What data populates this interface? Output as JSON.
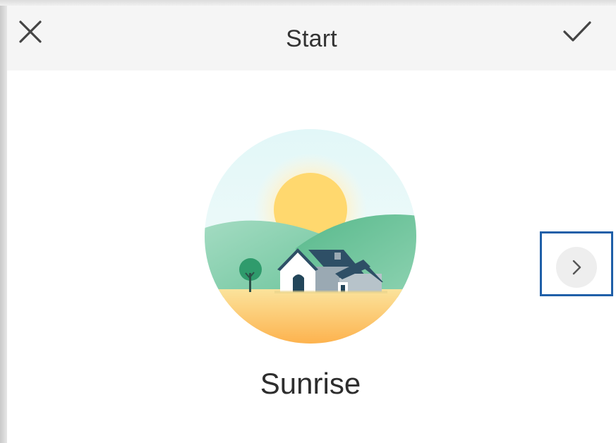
{
  "header": {
    "title": "Start",
    "close_icon": "close-icon",
    "confirm_icon": "checkmark-icon"
  },
  "theme": {
    "name": "Sunrise",
    "illustration": "sunrise-landscape-house-illustration"
  },
  "navigation": {
    "next_icon": "chevron-right-icon"
  },
  "colors": {
    "header_bg": "#f5f5f5",
    "text": "#333333",
    "highlight_border": "#1f5fa8",
    "sun": "#ffd56b",
    "hill_green": "#5dbb93",
    "field_yellow": "#fcd778"
  }
}
